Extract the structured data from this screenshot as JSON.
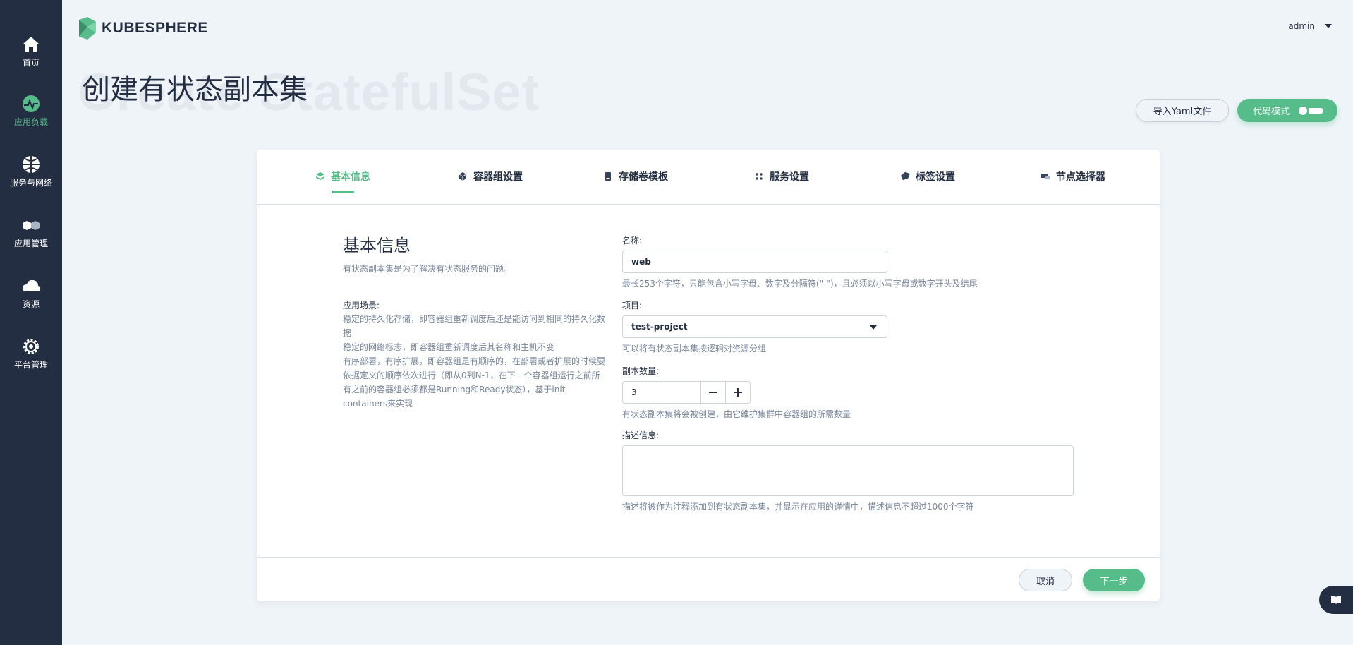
{
  "app": {
    "logo_text": "KUBESPHERE",
    "user": "admin"
  },
  "sidebar": {
    "items": [
      {
        "label": "首页",
        "icon": "home-icon"
      },
      {
        "label": "应用负载",
        "icon": "app-workload-icon",
        "active": true
      },
      {
        "label": "服务与网络",
        "icon": "network-icon"
      },
      {
        "label": "应用管理",
        "icon": "app-manage-icon"
      },
      {
        "label": "资源",
        "icon": "cloud-icon"
      },
      {
        "label": "平台管理",
        "icon": "gear-icon"
      }
    ]
  },
  "page": {
    "bg_title": "Create StatefulSet",
    "title": "创建有状态副本集",
    "import_yaml": "导入Yaml文件",
    "code_mode": "代码模式"
  },
  "tabs": [
    {
      "label": "基本信息",
      "icon": "layers-icon",
      "active": true
    },
    {
      "label": "容器组设置",
      "icon": "cube-icon"
    },
    {
      "label": "存储卷模板",
      "icon": "storage-icon"
    },
    {
      "label": "服务设置",
      "icon": "service-icon"
    },
    {
      "label": "标签设置",
      "icon": "tag-icon"
    },
    {
      "label": "节点选择器",
      "icon": "node-icon"
    }
  ],
  "info": {
    "title": "基本信息",
    "desc": "有状态副本集是为了解决有状态服务的问题。",
    "scene_label": "应用场景:",
    "scene_lines": [
      "稳定的持久化存储，即容器组重新调度后还是能访问到相同的持久化数据",
      "稳定的网络标志，即容器组重新调度后其名称和主机不变",
      "有序部署，有序扩展，即容器组是有顺序的，在部署或者扩展的时候要依据定义的顺序依次进行（即从0到N-1，在下一个容器组运行之前所有之前的容器组必须都是Running和Ready状态），基于init containers来实现"
    ]
  },
  "form": {
    "name_label": "名称:",
    "name_value": "web",
    "name_hint": "最长253个字符，只能包含小写字母、数字及分隔符(\"-\")，且必须以小写字母或数字开头及结尾",
    "project_label": "项目:",
    "project_value": "test-project",
    "project_hint": "可以将有状态副本集按逻辑对资源分组",
    "replicas_label": "副本数量:",
    "replicas_value": "3",
    "replicas_hint": "有状态副本集将会被创建，由它维护集群中容器组的所需数量",
    "desc_label": "描述信息:",
    "desc_value": "",
    "desc_hint": "描述将被作为注释添加到有状态副本集，并显示在应用的详情中，描述信息不超过1000个字符"
  },
  "footer": {
    "cancel": "取消",
    "next": "下一步"
  },
  "colors": {
    "primary": "#55bc8a",
    "sidebar": "#242e42",
    "background": "#eff4f9"
  }
}
